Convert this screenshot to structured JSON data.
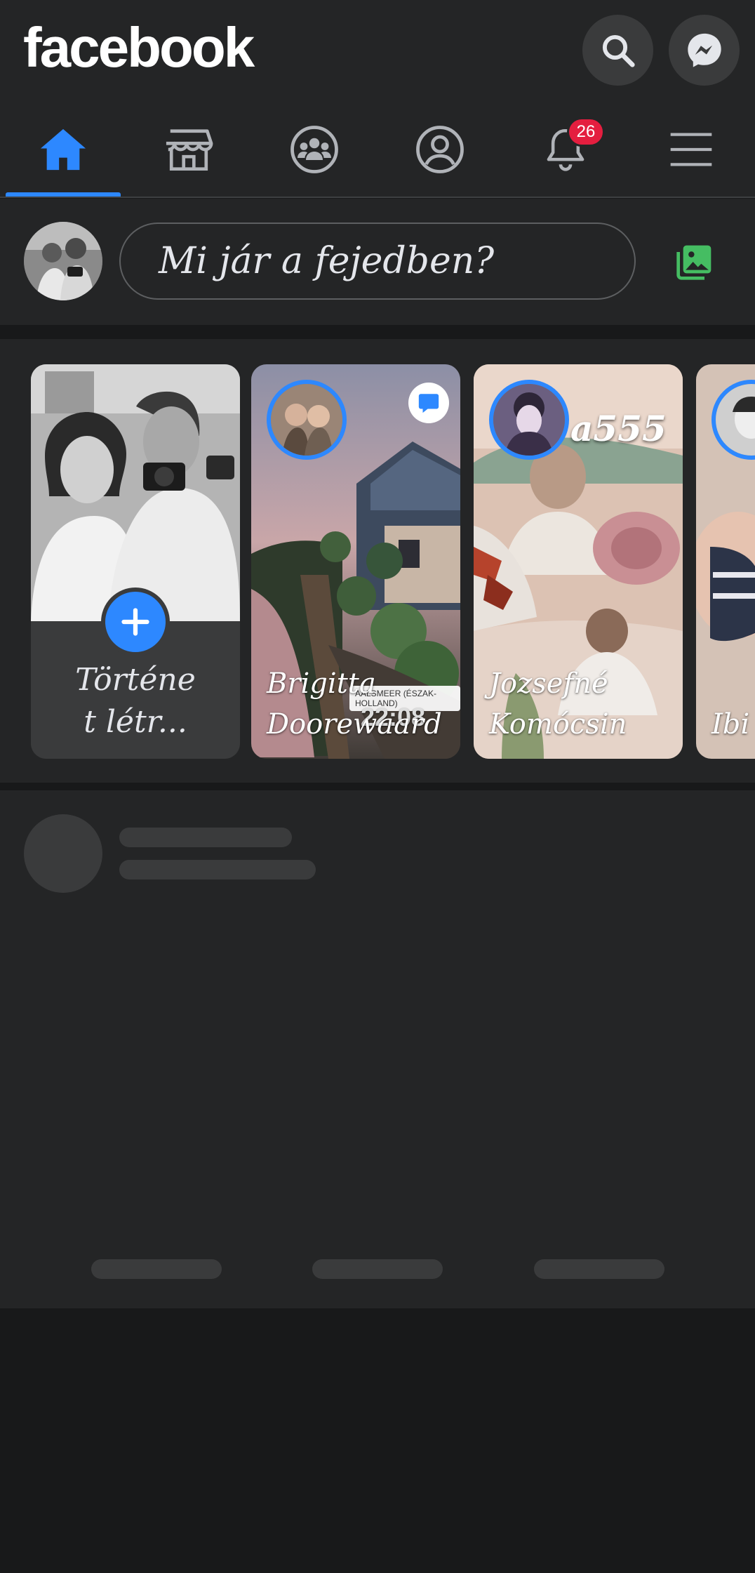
{
  "app": {
    "logo_text": "facebook"
  },
  "header": {
    "search_icon": "search-icon",
    "messenger_icon": "messenger-icon"
  },
  "nav": {
    "items": [
      {
        "icon": "home-icon",
        "active": true
      },
      {
        "icon": "marketplace-icon",
        "active": false
      },
      {
        "icon": "groups-icon",
        "active": false
      },
      {
        "icon": "profile-icon",
        "active": false
      },
      {
        "icon": "bell-icon",
        "active": false
      },
      {
        "icon": "menu-icon",
        "active": false
      }
    ],
    "notification_count": "26"
  },
  "composer": {
    "placeholder": "Mi jár a fejedben?",
    "photo_icon": "photo-icon"
  },
  "stories": {
    "create_label_line1": "Történe",
    "create_label_line2": "t létr...",
    "items": [
      {
        "name_line1": "Brigitta",
        "name_line2": "Doorewaard",
        "location_tag": "AALSMEER (ÉSZAK-HOLLAND)",
        "time_text": "22:08"
      },
      {
        "name_line1": "Jozsefné",
        "name_line2": "Komócsin",
        "overlay_text": "a555"
      },
      {
        "name_line1": "Ibi",
        "name_line2": ""
      }
    ]
  },
  "colors": {
    "accent": "#2d88ff",
    "badge": "#e41e3f",
    "surface": "#242526",
    "background": "#18191a",
    "photo_icon": "#45bd62"
  }
}
